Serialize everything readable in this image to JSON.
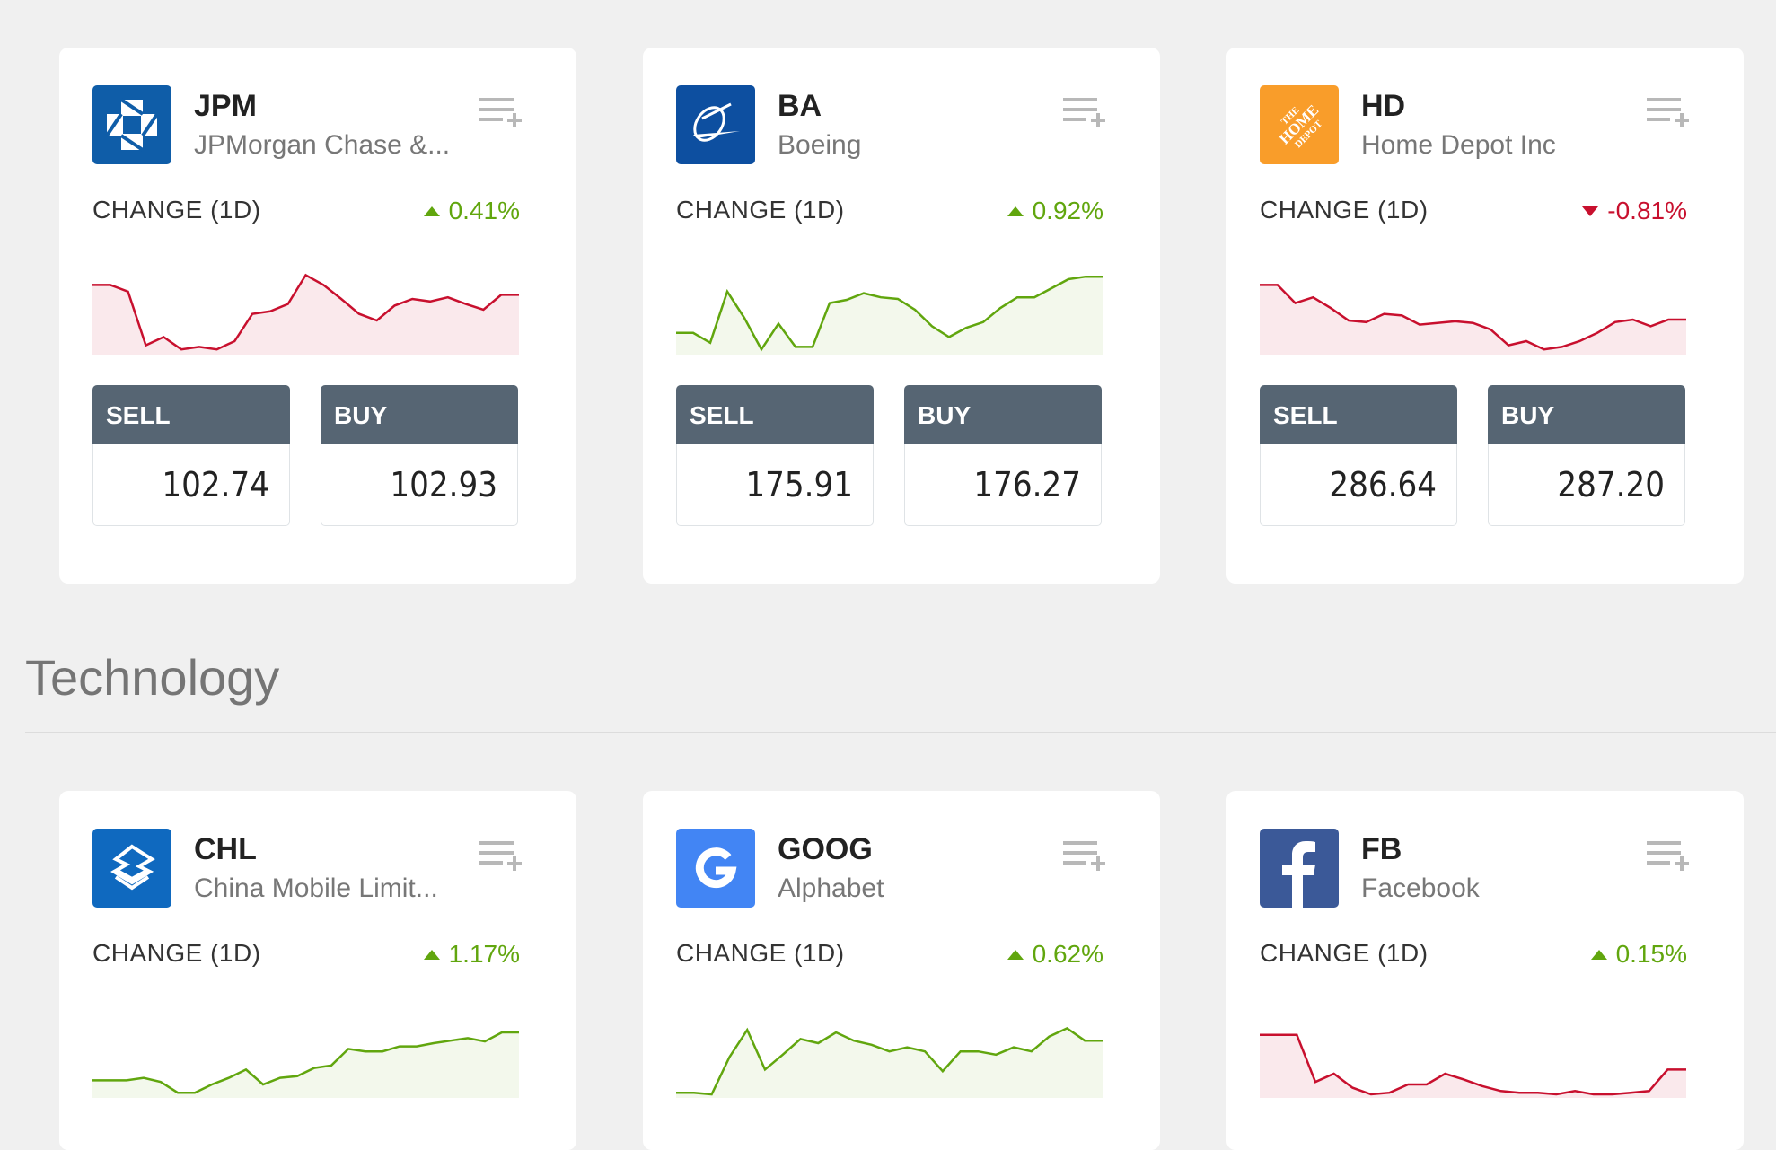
{
  "cards_top": [
    {
      "ticker": "JPM",
      "company": "JPMorgan Chase &...",
      "logo_icon": "chase-octagon-icon",
      "logo_bg": "#0f5da8",
      "change_label": "CHANGE (1D)",
      "change": "0.41%",
      "direction": "up",
      "sell_label": "SELL",
      "buy_label": "BUY",
      "sell_int": "102.",
      "sell_dec": "74",
      "buy_int": "102.",
      "buy_dec": "93",
      "spark": [
        20,
        20,
        28,
        93,
        83,
        98,
        95,
        98,
        88,
        55,
        52,
        43,
        8,
        20,
        37,
        55,
        63,
        45,
        37,
        40,
        35,
        43,
        50,
        32,
        32
      ]
    },
    {
      "ticker": "BA",
      "company": "Boeing",
      "logo_icon": "boeing-logo-icon",
      "logo_bg": "#0d4fa0",
      "change_label": "CHANGE (1D)",
      "change": "0.92%",
      "direction": "up",
      "sell_label": "SELL",
      "buy_label": "BUY",
      "sell_int": "175.",
      "sell_dec": "91",
      "buy_int": "176.",
      "buy_dec": "27",
      "spark": [
        78,
        78,
        90,
        28,
        60,
        98,
        67,
        95,
        95,
        42,
        38,
        30,
        35,
        37,
        50,
        70,
        83,
        72,
        65,
        48,
        35,
        35,
        24,
        13,
        10,
        10
      ]
    },
    {
      "ticker": "HD",
      "company": "Home Depot Inc",
      "logo_icon": "home-depot-logo-icon",
      "logo_bg": "#f99d2a",
      "change_label": "CHANGE (1D)",
      "change": "-0.81%",
      "direction": "down",
      "sell_label": "SELL",
      "buy_label": "BUY",
      "sell_int": "286.",
      "sell_dec": "64",
      "buy_int": "287.",
      "buy_dec": "20",
      "spark": [
        20,
        20,
        42,
        35,
        48,
        63,
        65,
        55,
        57,
        68,
        66,
        64,
        66,
        74,
        93,
        88,
        98,
        95,
        88,
        78,
        65,
        62,
        70,
        62,
        62
      ]
    }
  ],
  "section": {
    "title": "Technology"
  },
  "cards_bottom": [
    {
      "ticker": "CHL",
      "company": "China Mobile Limit...",
      "logo_icon": "china-mobile-logo-icon",
      "logo_bg": "#0f69bf",
      "change_label": "CHANGE (1D)",
      "change": "1.17%",
      "direction": "up",
      "spark": [
        83,
        83,
        83,
        80,
        85,
        98,
        98,
        88,
        80,
        70,
        88,
        80,
        78,
        68,
        65,
        45,
        48,
        48,
        42,
        42,
        38,
        35,
        32,
        36,
        25,
        25
      ]
    },
    {
      "ticker": "GOOG",
      "company": "Alphabet",
      "logo_icon": "google-g-icon",
      "logo_bg": "#4285f4",
      "change_label": "CHANGE (1D)",
      "change": "0.62%",
      "direction": "up",
      "spark": [
        98,
        98,
        100,
        55,
        22,
        70,
        52,
        33,
        38,
        25,
        35,
        40,
        48,
        43,
        48,
        72,
        48,
        48,
        52,
        43,
        48,
        30,
        20,
        35,
        35
      ]
    },
    {
      "ticker": "FB",
      "company": "Facebook",
      "logo_icon": "facebook-f-icon",
      "logo_bg": "#3b5998",
      "change_label": "CHANGE (1D)",
      "change": "0.15%",
      "direction": "up",
      "spark": [
        28,
        28,
        28,
        85,
        75,
        92,
        100,
        98,
        88,
        88,
        75,
        82,
        90,
        96,
        98,
        98,
        100,
        96,
        100,
        100,
        98,
        96,
        70,
        70
      ]
    }
  ],
  "colors": {
    "up": "#61a60e",
    "down": "#c8102e",
    "trade_header": "#566573"
  }
}
